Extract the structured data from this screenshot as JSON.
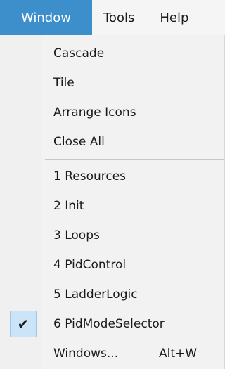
{
  "menubar": {
    "items": [
      {
        "label": "Window"
      },
      {
        "label": "Tools"
      },
      {
        "label": "Help"
      }
    ]
  },
  "window_menu": {
    "items": [
      {
        "label": "Cascade"
      },
      {
        "label": "Tile"
      },
      {
        "label": "Arrange Icons"
      },
      {
        "label": "Close All"
      },
      {
        "label": "1 Resources"
      },
      {
        "label": "2 Init"
      },
      {
        "label": "3 Loops"
      },
      {
        "label": "4 PidControl"
      },
      {
        "label": "5 LadderLogic"
      },
      {
        "label": "6 PidModeSelector",
        "checked": true
      },
      {
        "label": "Windows...",
        "shortcut": "Alt+W"
      }
    ]
  },
  "icons": {
    "checkmark": "checkmark-icon"
  },
  "colors": {
    "menubar_active": "#3d8fcc",
    "check_highlight": "#cce4f7"
  }
}
